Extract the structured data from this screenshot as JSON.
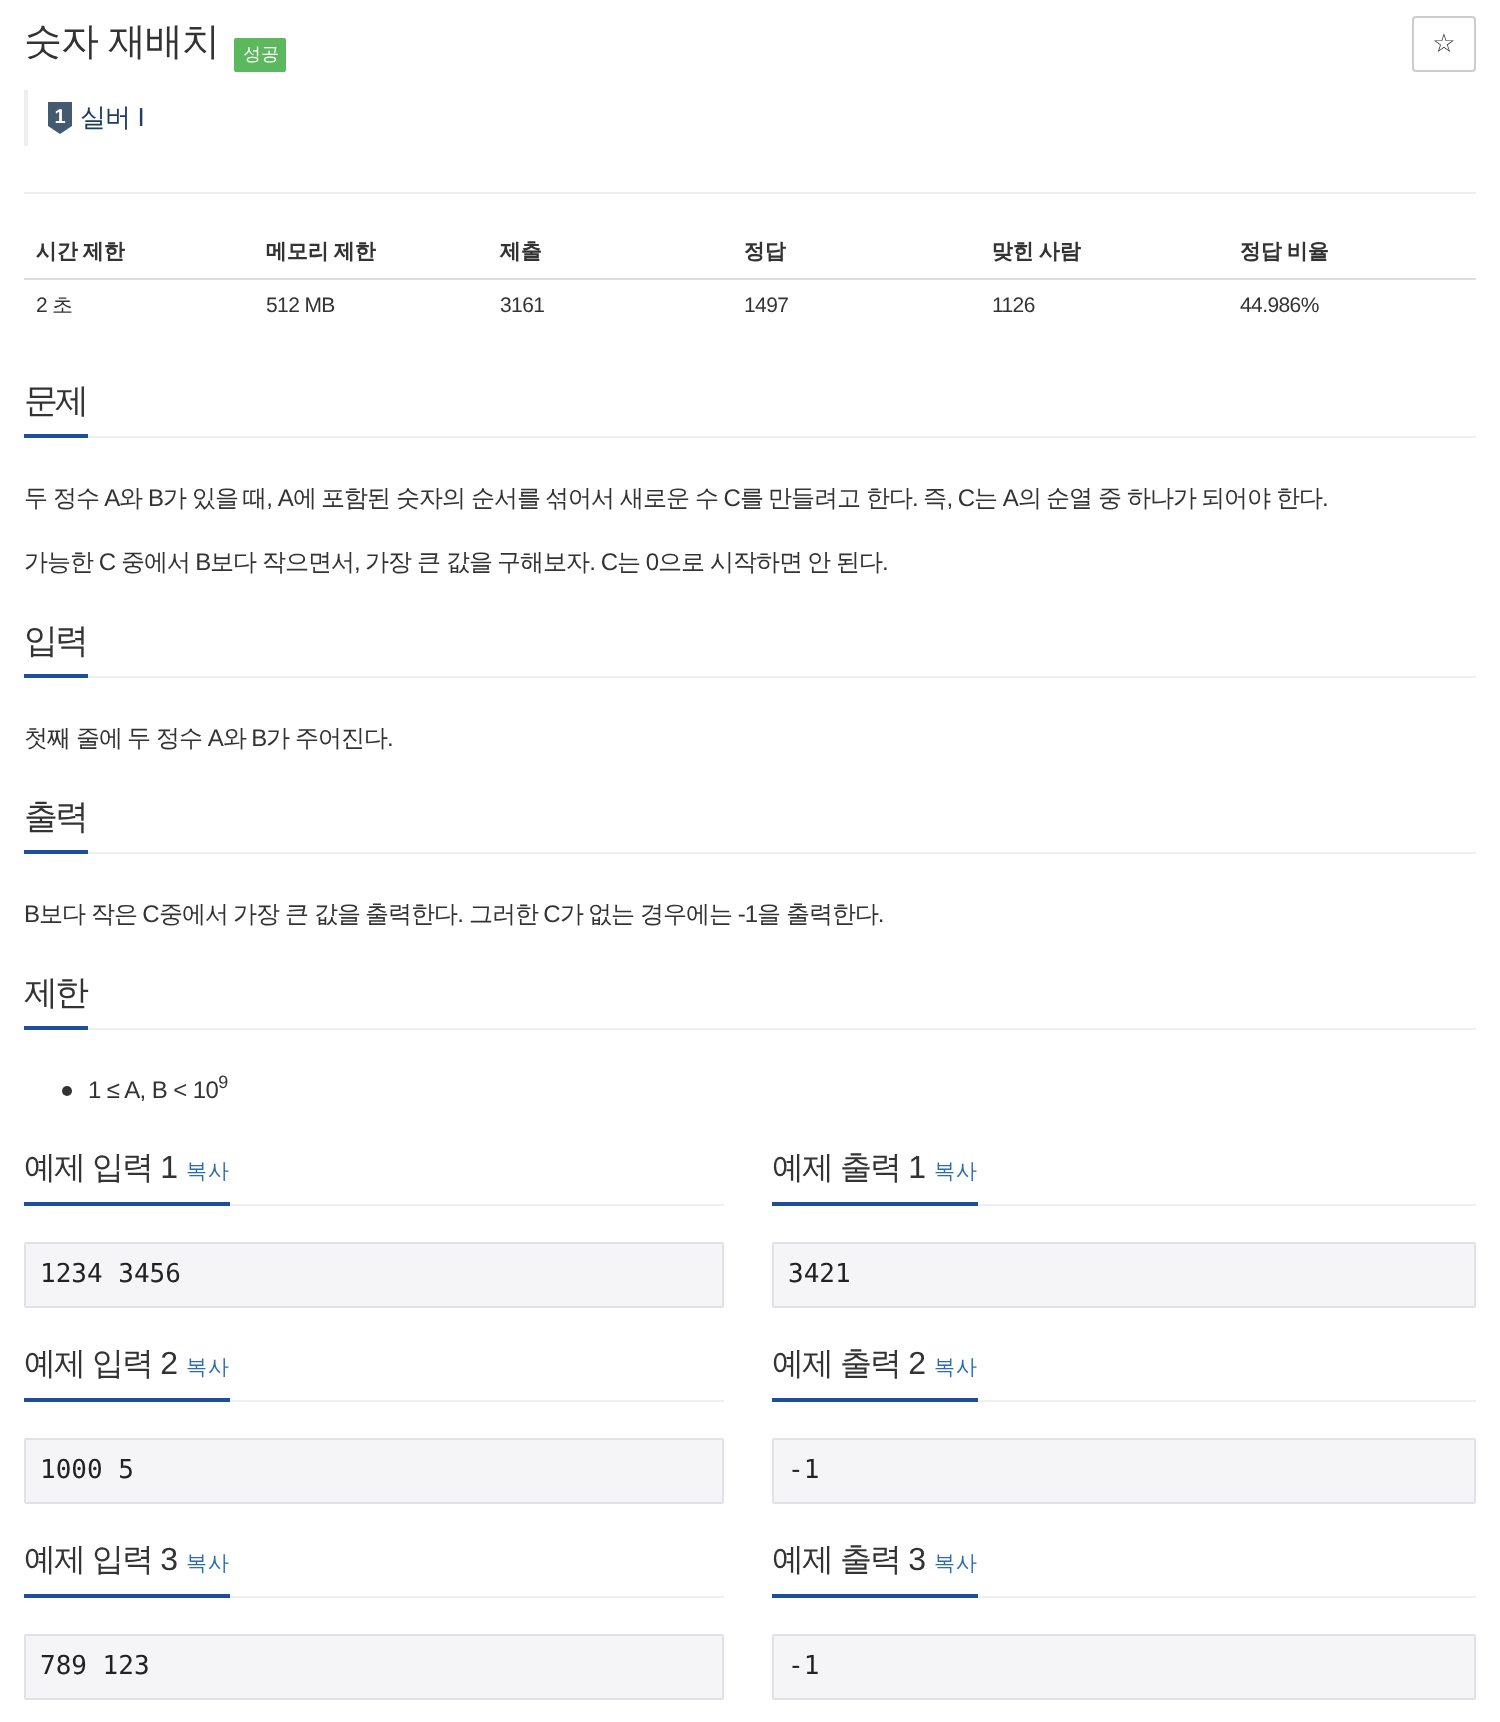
{
  "title": "숫자 재배치",
  "status_badge": "성공",
  "star_button": "☆",
  "tier": {
    "icon_number": "1",
    "label": "실버 I"
  },
  "stats": {
    "columns": [
      "시간 제한",
      "메모리 제한",
      "제출",
      "정답",
      "맞힌 사람",
      "정답 비율"
    ],
    "rows": [
      [
        "2 초",
        "512 MB",
        "3161",
        "1497",
        "1126",
        "44.986%"
      ]
    ]
  },
  "sections": [
    {
      "heading": "문제",
      "kind": "paragraphs",
      "items": [
        "두 정수 A와 B가 있을 때, A에 포함된 숫자의 순서를 섞어서 새로운 수 C를 만들려고 한다. 즉, C는 A의 순열 중 하나가 되어야 한다.",
        "가능한 C 중에서 B보다 작으면서, 가장 큰 값을 구해보자. C는 0으로 시작하면 안 된다."
      ]
    },
    {
      "heading": "입력",
      "kind": "paragraphs",
      "items": [
        "첫째 줄에 두 정수 A와 B가 주어진다."
      ]
    },
    {
      "heading": "출력",
      "kind": "paragraphs",
      "items": [
        "B보다 작은 C중에서 가장 큰 값을 출력한다. 그러한 C가 없는 경우에는 -1을 출력한다."
      ]
    },
    {
      "heading": "제한",
      "kind": "bullets",
      "items": [
        "1 ≤ A, B < 10$^{9}$"
      ]
    }
  ],
  "samples": [
    {
      "input": {
        "heading": "예제 입력 1",
        "copy_link": "복사",
        "data": "1234 3456"
      },
      "output": {
        "heading": "예제 출력 1",
        "copy_link": "복사",
        "data": "3421"
      }
    },
    {
      "input": {
        "heading": "예제 입력 2",
        "copy_link": "복사",
        "data": "1000 5"
      },
      "output": {
        "heading": "예제 출력 2",
        "copy_link": "복사",
        "data": "-1"
      }
    },
    {
      "input": {
        "heading": "예제 입력 3",
        "copy_link": "복사",
        "data": "789 123"
      },
      "output": {
        "heading": "예제 출력 3",
        "copy_link": "복사",
        "data": "-1"
      }
    }
  ]
}
